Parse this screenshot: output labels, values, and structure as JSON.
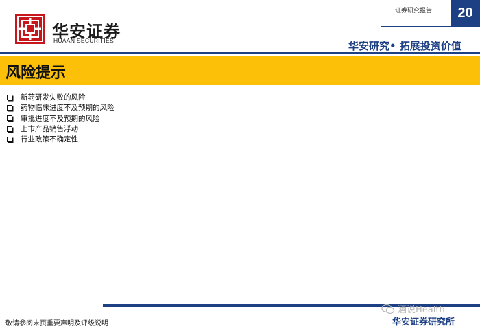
{
  "header": {
    "brand_cn": "华安证券",
    "brand_en": "HUAAN SECURITIES",
    "report_type": "证券研究报告",
    "page_number": "20",
    "slogan": "华安研究• 拓展投资价值"
  },
  "section": {
    "title": "风险提示"
  },
  "risks": [
    {
      "text": "新药研发失败的风险"
    },
    {
      "text": "药物临床进度不及预期的风险"
    },
    {
      "text": "审批进度不及预期的风险"
    },
    {
      "text": "上市产品销售浮动"
    },
    {
      "text": "行业政策不确定性"
    }
  ],
  "footer": {
    "disclaimer": "敬请参阅末页重要声明及评级说明",
    "institute": "华安证券研究所",
    "watermark": "酒说Health"
  },
  "colors": {
    "brand_blue": "#1d3f84",
    "title_bar": "#fbc007",
    "logo_red": "#c8161d"
  }
}
